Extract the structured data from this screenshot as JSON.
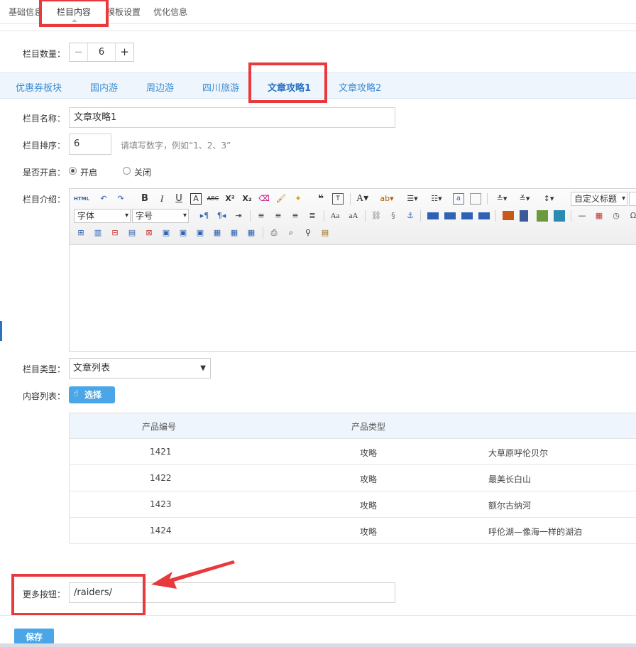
{
  "top_tabs": [
    {
      "label": "基础信息"
    },
    {
      "label": "栏目内容"
    },
    {
      "label": "模板设置"
    },
    {
      "label": "优化信息"
    }
  ],
  "column_count": {
    "label": "栏目数量：",
    "minus": "−",
    "value": "6",
    "plus": "+"
  },
  "sub_tabs": [
    {
      "label": "优惠券板块"
    },
    {
      "label": "国内游"
    },
    {
      "label": "周边游"
    },
    {
      "label": "四川旅游"
    },
    {
      "label": "文章攻略1"
    },
    {
      "label": "文章攻略2"
    }
  ],
  "form": {
    "name_label": "栏目名称：",
    "name_value": "文章攻略1",
    "sort_label": "栏目排序：",
    "sort_value": "6",
    "sort_hint": "请填写数字，例如“1、2、3”",
    "open_label": "是否开启：",
    "open_on": "开启",
    "open_off": "关闭",
    "intro_label": "栏目介绍：",
    "type_label": "栏目类型：",
    "type_value": "文章列表",
    "content_label": "内容列表：",
    "choose_label": "选择",
    "more_label": "更多按钮：",
    "more_value": "/raiders/",
    "save_label": "保存"
  },
  "editor": {
    "html_label": "HTML",
    "custom_title": "自定义标题",
    "font_label": "字体",
    "size_label": "字号"
  },
  "table": {
    "headers": [
      "产品编号",
      "产品类型"
    ],
    "rows": [
      {
        "id": "1421",
        "type": "攻略",
        "name": "大草原呼伦贝尔"
      },
      {
        "id": "1422",
        "type": "攻略",
        "name": "最美长白山"
      },
      {
        "id": "1423",
        "type": "攻略",
        "name": "额尔古纳河"
      },
      {
        "id": "1424",
        "type": "攻略",
        "name": "呼伦湖—像海一样的湖泊"
      }
    ]
  },
  "colors": {
    "accent": "#4aa6e6",
    "highlight": "#e8393c",
    "tab_blue": "#3b8cd4"
  }
}
